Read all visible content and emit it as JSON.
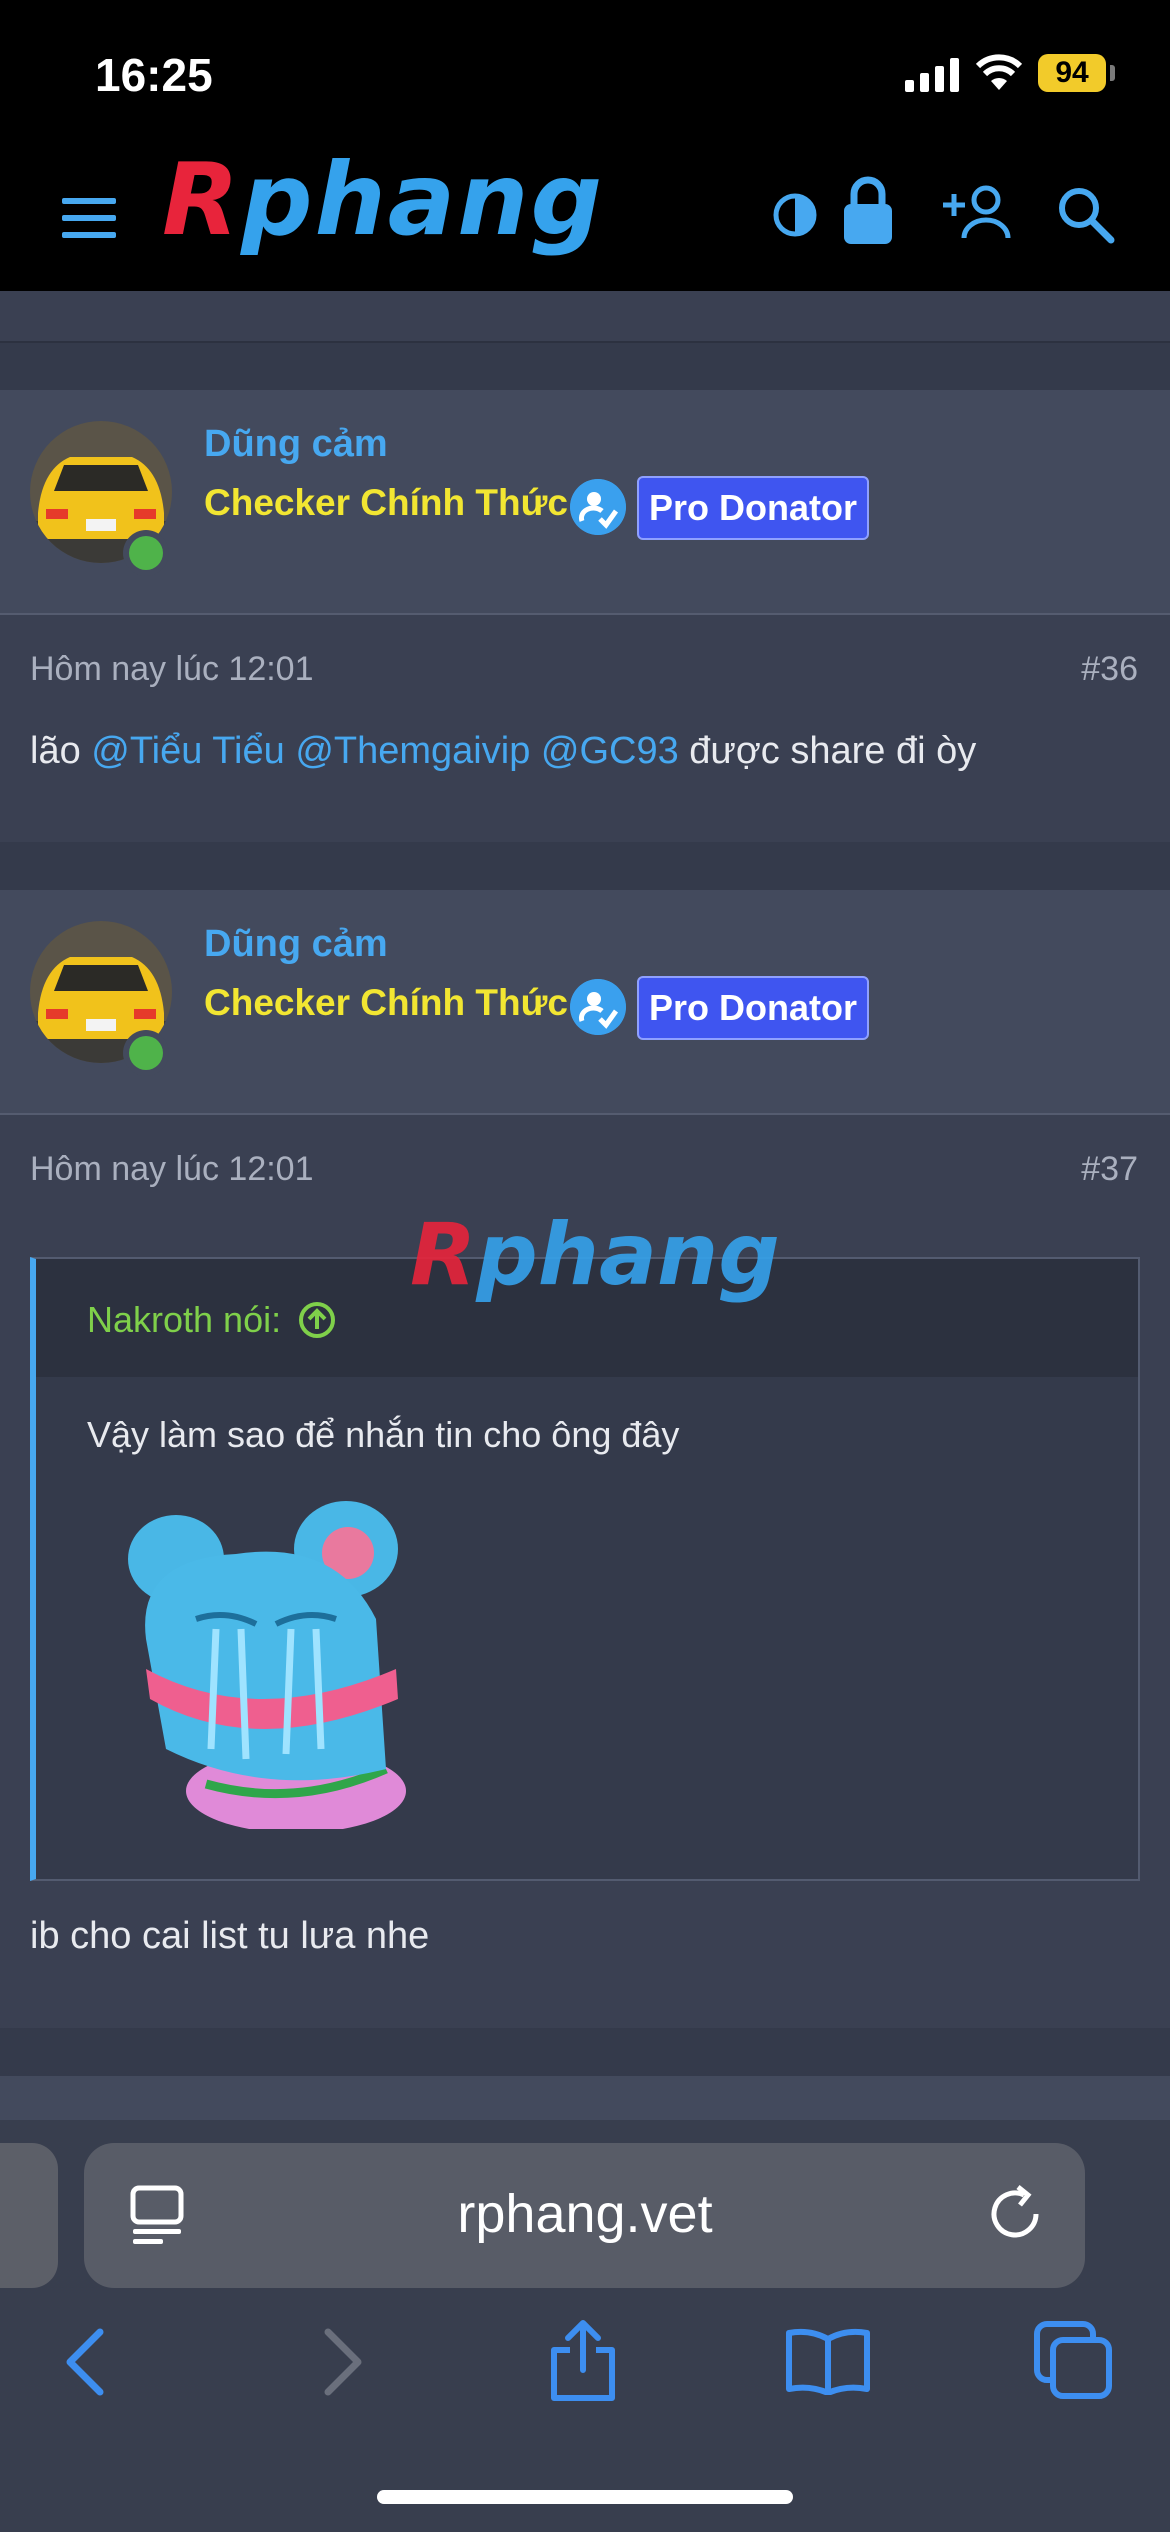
{
  "status_bar": {
    "time": "16:25",
    "battery": "94"
  },
  "header": {
    "logo_r": "R",
    "logo_rest": "phang"
  },
  "posts": [
    {
      "username": "Dũng cảm",
      "user_title": "Checker Chính Thức",
      "badge": "Pro Donator",
      "date": "Hôm nay lúc 12:01",
      "number": "#36",
      "text_before": "lão ",
      "mentions": [
        "@Tiểu Tiểu",
        "@Themgaivip",
        "@GC93"
      ],
      "text_after": " được share đi òy"
    },
    {
      "username": "Dũng cảm",
      "user_title": "Checker Chính Thức",
      "badge": "Pro Donator",
      "date": "Hôm nay lúc 12:01",
      "number": "#37",
      "quote": {
        "author": "Nakroth nói:",
        "text": "Vậy làm sao để nhắn tin cho ông đây"
      },
      "text": "ib cho cai list tu lưa nhe"
    }
  ],
  "watermark": {
    "r": "R",
    "rest": "phang"
  },
  "browser": {
    "url": "rphang.vet"
  },
  "colors": {
    "accent": "#47a8f0",
    "title_yellow": "#f2e632",
    "badge_blue": "#3f55f0",
    "online_green": "#4fb34a"
  }
}
